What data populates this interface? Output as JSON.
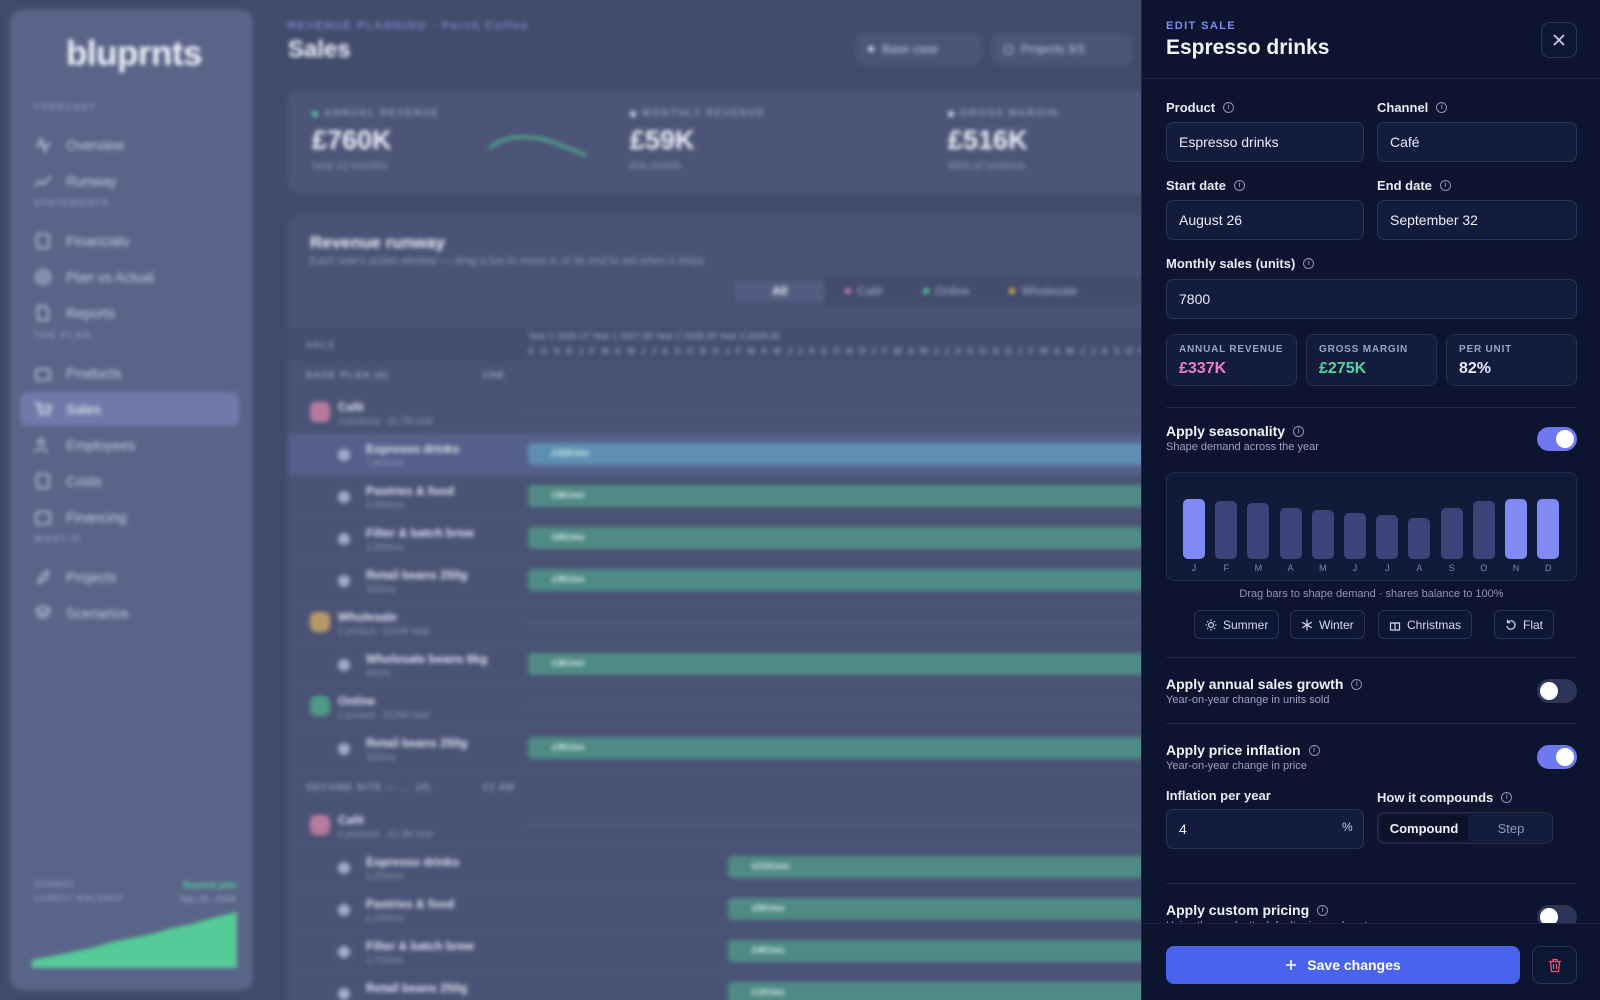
{
  "app": {
    "logo": "bluprnts",
    "nav_sections": [
      "FORECAST",
      "STATEMENTS",
      "THE PLAN",
      "WHAT-IF"
    ],
    "nav": [
      {
        "label": "Overview",
        "icon": "pulse-icon"
      },
      {
        "label": "Runway",
        "icon": "trend-icon"
      },
      {
        "label": "Financials",
        "icon": "sheet-icon"
      },
      {
        "label": "Plan vs Actual",
        "icon": "target-icon"
      },
      {
        "label": "Reports",
        "icon": "document-icon"
      },
      {
        "label": "Products",
        "icon": "box-icon"
      },
      {
        "label": "Sales",
        "icon": "cart-icon"
      },
      {
        "label": "Employees",
        "icon": "people-icon"
      },
      {
        "label": "Costs",
        "icon": "receipt-icon"
      },
      {
        "label": "Financing",
        "icon": "bank-icon"
      },
      {
        "label": "Projects",
        "icon": "rocket-icon"
      },
      {
        "label": "Scenarios",
        "icon": "layers-icon"
      }
    ],
    "active_nav": "Sales",
    "runway_widget": {
      "label1": "RUNWAY",
      "label2": "LOWEST BALANCE",
      "value1": "Beyond plan",
      "value2": "Sep 28 · £60K"
    }
  },
  "page": {
    "kicker": "REVENUE PLANNING · Perch Coffee",
    "title": "Sales",
    "scenario_pill": "Base case",
    "projects_pill": "Projects 3/3"
  },
  "kpis": [
    {
      "label": "ANNUAL REVENUE",
      "value": "£760K",
      "sub": "next 12 months",
      "dot": "#54d69a"
    },
    {
      "label": "MONTHLY REVENUE",
      "value": "£59K",
      "sub": "this month",
      "dot": "#d6dbee"
    },
    {
      "label": "GROSS MARGIN",
      "value": "£516K",
      "sub": "68% of revenue",
      "dot": "#d6dbee"
    }
  ],
  "runway_panel": {
    "title": "Revenue runway",
    "subtitle": "Each sale's active window — drag a bar to move it, or its end to set when it stops",
    "tabs": [
      {
        "label": "All",
        "color": ""
      },
      {
        "label": "Café",
        "color": "#d77fb0"
      },
      {
        "label": "Online",
        "color": "#54d69a"
      },
      {
        "label": "Wholesale",
        "color": "#e7b45b"
      }
    ],
    "col_header": "SALE",
    "years": "Year 0 2026-27    Year 1 2027-28        Year 2 2028-29        Year 3 2029-30",
    "months": "SONDJFMAMJJASONDJFMAMJJASONDJFMAMJJASONDJFMAMJJASON",
    "sections": [
      {
        "label": "BASE PLAN  (6)",
        "total": "£9M"
      },
      {
        "label": "SECOND SITE — ...  (4)",
        "total": "£1.6M"
      }
    ],
    "rows": [
      {
        "name": "Café",
        "sub": "4 products · £1.7M total",
        "type": "group",
        "color": "#b87a9e"
      },
      {
        "name": "Espresso drinks",
        "sub": "7,800/mo",
        "type": "item",
        "bar": "£32K/mo",
        "selected": true
      },
      {
        "name": "Pastries & food",
        "sub": "3,900/mo",
        "type": "item",
        "bar": "£9K/mo"
      },
      {
        "name": "Filter & batch brew",
        "sub": "2,300/mo",
        "type": "item",
        "bar": "£6K/mo"
      },
      {
        "name": "Retail beans 250g",
        "sub": "300/mo",
        "type": "item",
        "bar": "£3K/mo"
      },
      {
        "name": "Wholesale",
        "sub": "1 product · £324K total",
        "type": "group",
        "color": "#b79a6a"
      },
      {
        "name": "Wholesale beans 6kg",
        "sub": "45/mo",
        "type": "item",
        "bar": "£3K/mo"
      },
      {
        "name": "Online",
        "sub": "1 product · £126K total",
        "type": "group",
        "color": "#4f9a86"
      },
      {
        "name": "Retail beans 250g",
        "sub": "320/mo",
        "type": "item",
        "bar": "£3K/mo"
      },
      {
        "name": "Café",
        "sub": "4 products · £1.3M total",
        "type": "group",
        "color": "#b87a9e"
      },
      {
        "name": "Espresso drinks",
        "sub": "5,200/mo",
        "type": "item",
        "bar": "£21K/mo"
      },
      {
        "name": "Pastries & food",
        "sub": "2,100/mo",
        "type": "item",
        "bar": "£5K/mo"
      },
      {
        "name": "Filter & batch brew",
        "sub": "1,700/mo",
        "type": "item",
        "bar": "£4K/mo"
      },
      {
        "name": "Retail beans 250g",
        "sub": "",
        "type": "item",
        "bar": "£1K/mo"
      }
    ]
  },
  "drawer": {
    "kicker": "EDIT SALE",
    "title": "Espresso drinks",
    "product_label": "Product",
    "product_value": "Espresso drinks",
    "channel_label": "Channel",
    "channel_value": "Café",
    "start_label": "Start date",
    "start_value": "August 26",
    "end_label": "End date",
    "end_value": "September 32",
    "units_label": "Monthly sales (units)",
    "units_value": "7800",
    "stats": [
      {
        "label": "ANNUAL REVENUE",
        "value": "£337K",
        "color": "#f17ec3"
      },
      {
        "label": "GROSS MARGIN",
        "value": "£275K",
        "color": "#4fd79c"
      },
      {
        "label": "PER UNIT",
        "value": "82%",
        "color": "#e6e9f5"
      }
    ],
    "seasonality": {
      "title": "Apply seasonality",
      "sub": "Shape demand across the year",
      "enabled": true,
      "months": [
        "J",
        "F",
        "M",
        "A",
        "M",
        "J",
        "J",
        "A",
        "S",
        "O",
        "N",
        "D"
      ],
      "levels": [
        1.0,
        0.96,
        0.93,
        0.85,
        0.81,
        0.77,
        0.73,
        0.69,
        0.85,
        0.96,
        1.0,
        1.0
      ],
      "highlighted": [
        true,
        false,
        false,
        false,
        false,
        false,
        false,
        false,
        false,
        false,
        true,
        true
      ],
      "hint": "Drag bars to shape demand · shares balance to 100%",
      "presets": [
        {
          "label": "Summer",
          "icon": "sun-icon"
        },
        {
          "label": "Winter",
          "icon": "snowflake-icon"
        },
        {
          "label": "Christmas",
          "icon": "gift-icon"
        },
        {
          "label": "Flat",
          "icon": "reset-icon"
        }
      ]
    },
    "growth": {
      "title": "Apply annual sales growth",
      "sub": "Year-on-year change in units sold",
      "enabled": false
    },
    "inflation": {
      "title": "Apply price inflation",
      "sub": "Year-on-year change in price",
      "enabled": true,
      "rate_label": "Inflation per year",
      "rate_value": "4",
      "unit": "%",
      "compound_label": "How it compounds",
      "options": [
        "Compound",
        "Step"
      ],
      "selected": "Compound"
    },
    "custom_pricing": {
      "title": "Apply custom pricing",
      "sub": "Using the product's default price and costs",
      "enabled": false
    },
    "save_label": "Save changes"
  }
}
